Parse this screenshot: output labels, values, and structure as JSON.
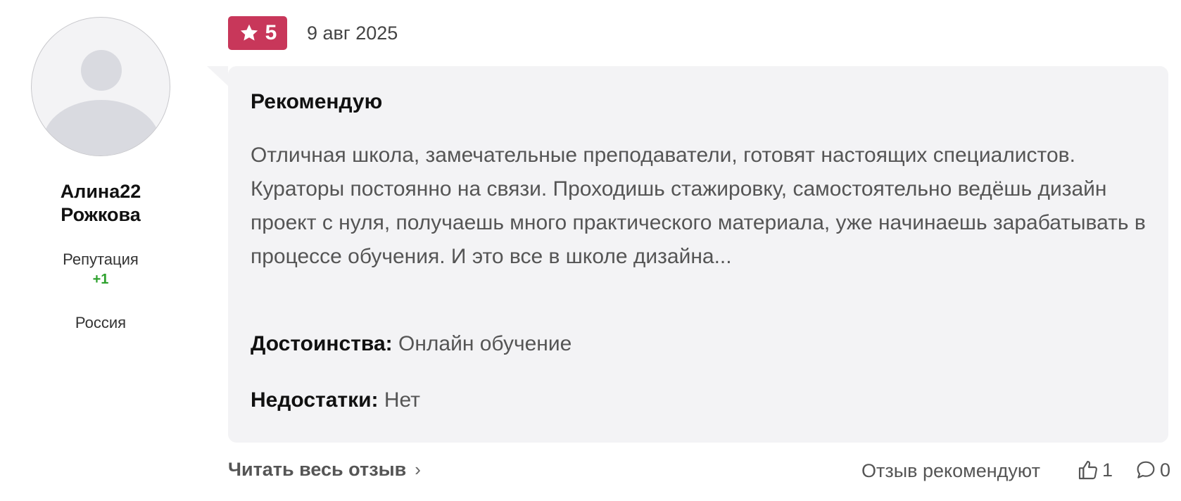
{
  "author": {
    "name": "Алина22 Рожкова",
    "reputation_label": "Репутация",
    "reputation_value": "+1",
    "country": "Россия"
  },
  "review": {
    "rating": "5",
    "date": "9 авг 2025",
    "title": "Рекомендую",
    "text": "Отличная школа, замечательные преподаватели, готовят настоящих специалистов. Кураторы постоянно на связи. Проходишь стажировку, самостоятельно ведёшь дизайн проект с нуля, получаешь много практического материала, уже начинаешь зарабатывать в процессе обучения. И это все в школе дизайна...",
    "pros_label": "Достоинства:",
    "pros": "Онлайн обучение",
    "cons_label": "Недостатки:",
    "cons": "Нет"
  },
  "footer": {
    "read_more": "Читать весь отзыв",
    "recommend_label": "Отзыв рекомендуют",
    "likes": "1",
    "comments": "0"
  },
  "colors": {
    "rating_badge": "#c8375a",
    "reputation_positive": "#2ea12e",
    "card_background": "#f3f3f5"
  },
  "icons": [
    "star-icon",
    "chevron-right-icon",
    "thumbs-up-icon",
    "comment-icon",
    "avatar-placeholder-icon"
  ]
}
